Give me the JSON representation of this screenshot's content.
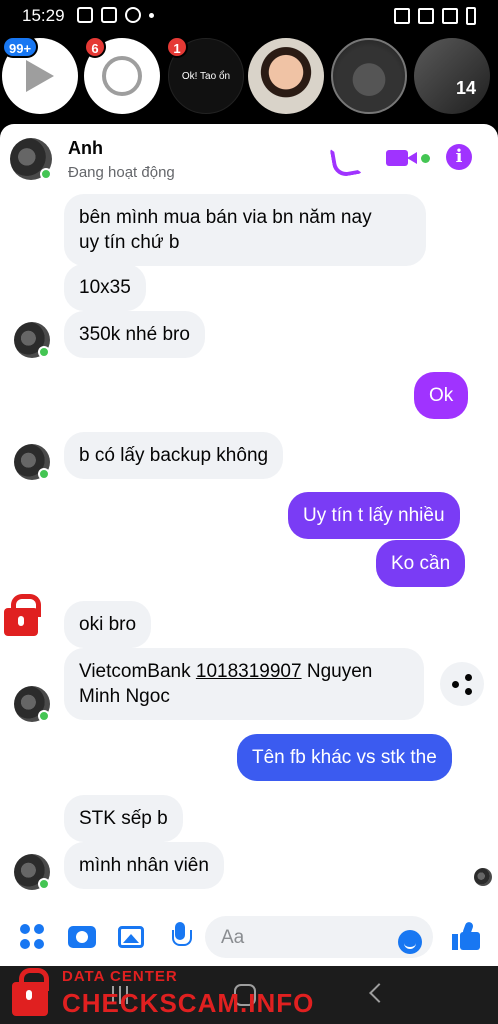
{
  "status_bar": {
    "time": "15:29"
  },
  "chat_heads": {
    "badge_1": "99+",
    "badge_2": "6",
    "badge_3": "1",
    "story_text": "Ok! Tao ổn",
    "jersey_text": "14"
  },
  "header": {
    "name": "Anh",
    "status": "Đang hoạt động"
  },
  "messages": [
    {
      "dir": "in",
      "text": "bên mình mua bán via bn năm nay\nuy tín chứ b"
    },
    {
      "dir": "in",
      "text": "10x35"
    },
    {
      "dir": "in",
      "text": "350k nhé bro"
    },
    {
      "dir": "out",
      "text": "Ok"
    },
    {
      "dir": "in",
      "text": "b có lấy backup không"
    },
    {
      "dir": "out",
      "text": "Uy tín t lấy nhiều"
    },
    {
      "dir": "out",
      "text": "Ko cần"
    },
    {
      "dir": "in",
      "text": "oki bro"
    },
    {
      "dir": "in",
      "text_prefix": "VietcomBank ",
      "account_number": "1018319907",
      "text_suffix": " Nguyen\nMinh Ngoc"
    },
    {
      "dir": "out",
      "text": "Tên fb khác vs stk the"
    },
    {
      "dir": "in",
      "text": "STK sếp b"
    },
    {
      "dir": "in",
      "text": "mình nhân viên"
    }
  ],
  "composer": {
    "placeholder": "Aa"
  },
  "watermark": {
    "sub": "DATA CENTER",
    "main": "CHECKSCAM.INFO"
  },
  "icons": [
    "play-icon",
    "messenger-icon",
    "phone-icon",
    "video-icon",
    "info-icon",
    "share-icon",
    "apps-icon",
    "camera-icon",
    "image-icon",
    "mic-icon",
    "emoji-icon",
    "like-icon",
    "lock-icon"
  ],
  "colors": {
    "accent_purple": "#a033ff",
    "bubble_blue": "#3b5bf0",
    "incoming_bg": "#f0f2f5",
    "online": "#44c553",
    "watermark_red": "#e02020"
  }
}
